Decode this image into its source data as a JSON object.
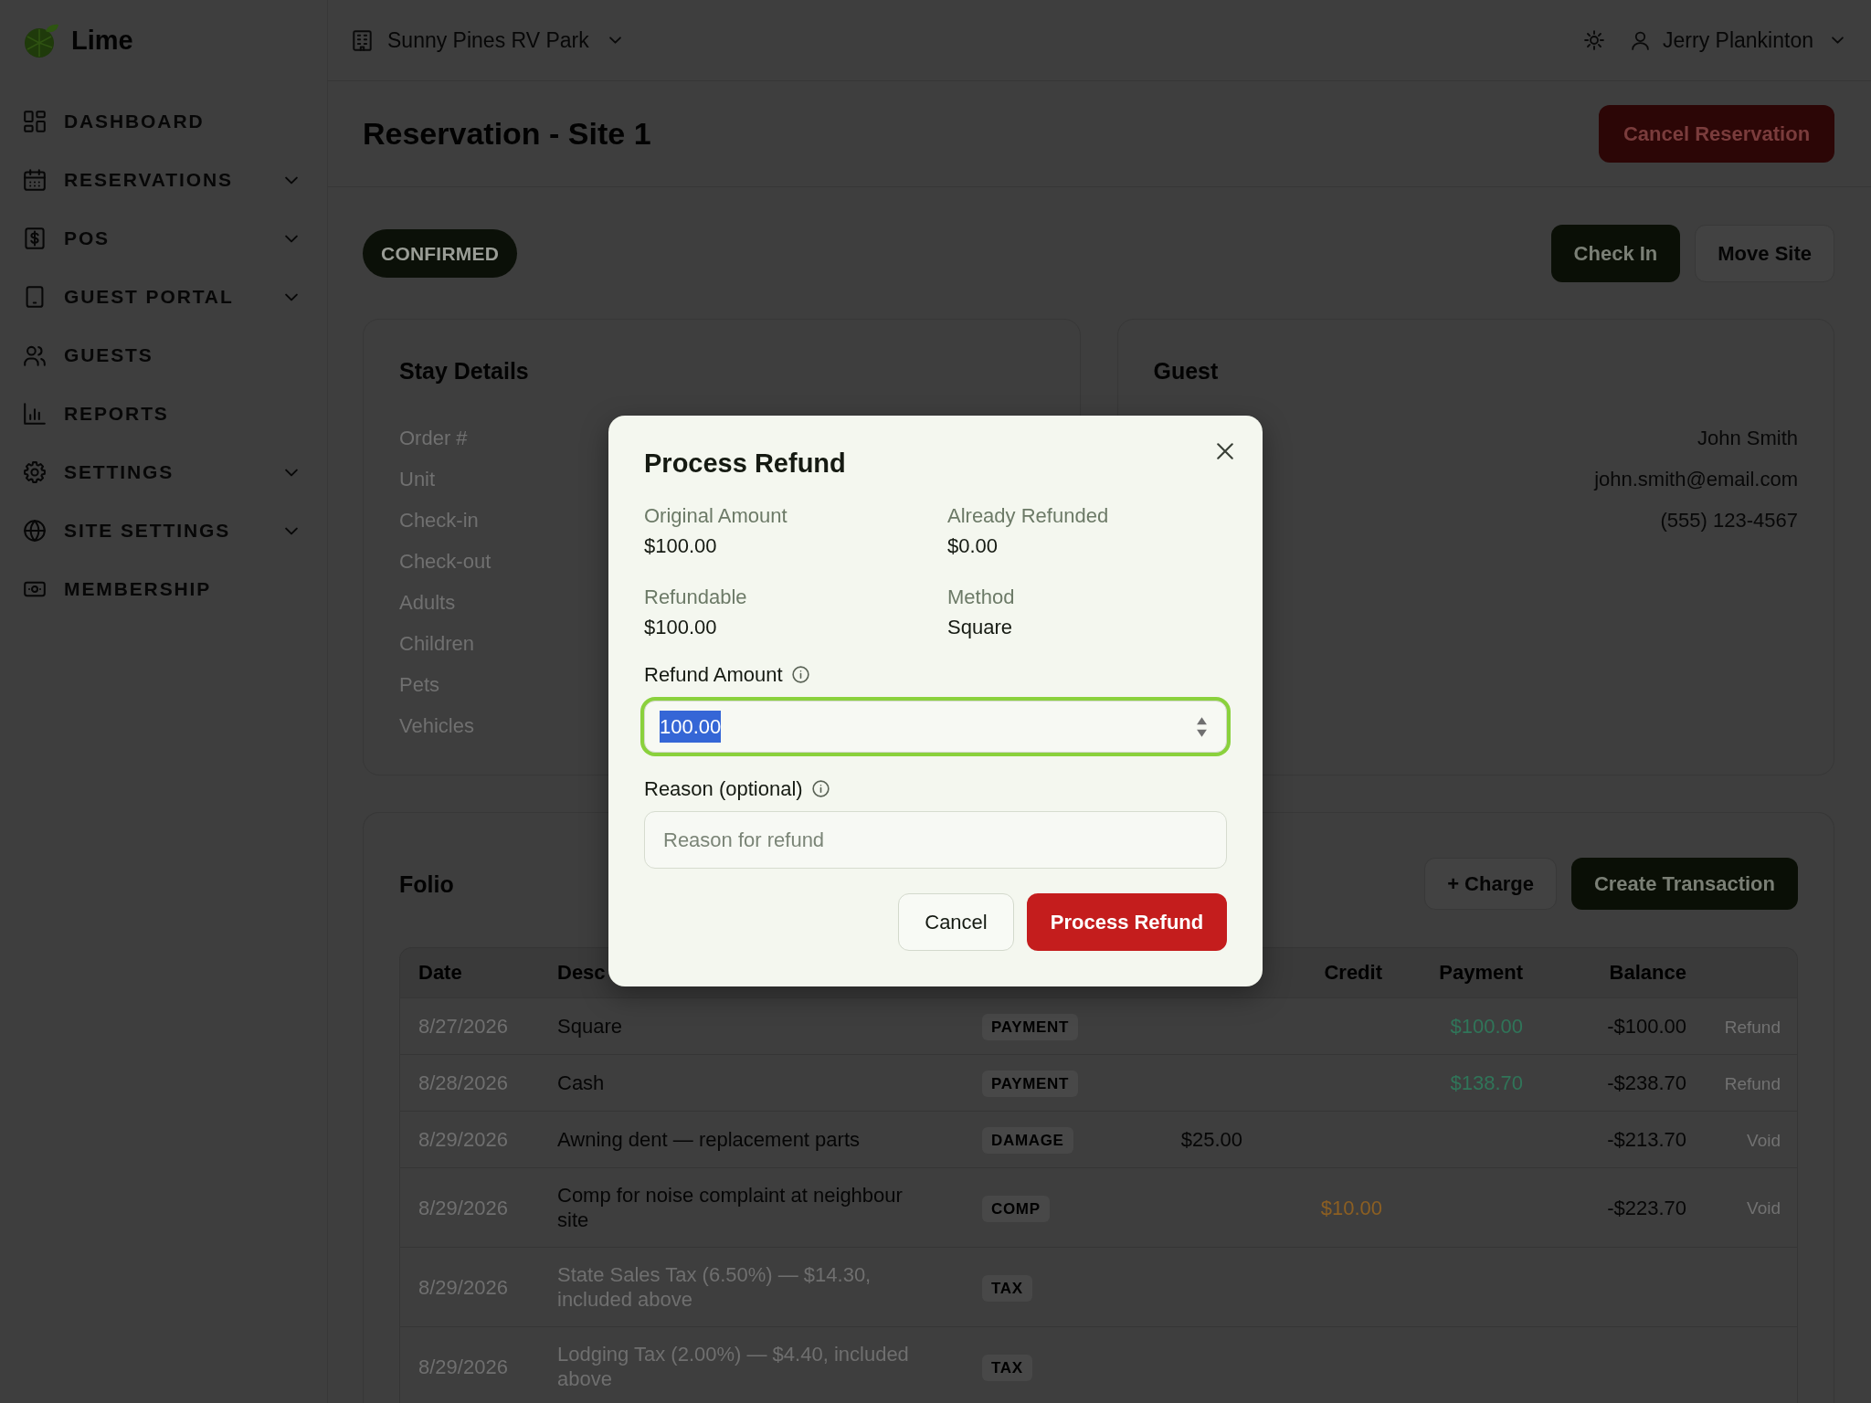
{
  "brand": {
    "name": "Lime"
  },
  "sidebar": {
    "items": [
      {
        "label": "DASHBOARD",
        "submenu": false
      },
      {
        "label": "RESERVATIONS",
        "submenu": true
      },
      {
        "label": "POS",
        "submenu": true
      },
      {
        "label": "GUEST PORTAL",
        "submenu": true
      },
      {
        "label": "GUESTS",
        "submenu": false
      },
      {
        "label": "REPORTS",
        "submenu": false
      },
      {
        "label": "SETTINGS",
        "submenu": true
      },
      {
        "label": "SITE SETTINGS",
        "submenu": true
      },
      {
        "label": "MEMBERSHIP",
        "submenu": false
      }
    ]
  },
  "top_bar": {
    "property": "Sunny Pines RV Park",
    "user": "Jerry Plankinton"
  },
  "header": {
    "title": "Reservation - Site 1",
    "cancel_button": "Cancel Reservation"
  },
  "status": {
    "label": "CONFIRMED"
  },
  "actions": [
    {
      "label": "Check In",
      "kind": "primary"
    },
    {
      "label": "Move Site",
      "kind": "outline"
    }
  ],
  "stay_details": {
    "title": "Stay Details",
    "labels": [
      "Order #",
      "Unit",
      "Check-in",
      "Check-out",
      "Adults",
      "Children",
      "Pets",
      "Vehicles"
    ]
  },
  "guest": {
    "title": "Guest",
    "values": [
      "John Smith",
      "john.smith@email.com",
      "(555) 123-4567"
    ]
  },
  "folio": {
    "title": "Folio",
    "buttons": [
      {
        "label": "+ Charge",
        "kind": "outline"
      },
      {
        "label": "Create Transaction",
        "kind": "primary"
      }
    ],
    "table": {
      "columns": [
        "Date",
        "Desc",
        null,
        null,
        "Credit",
        "Payment",
        "Balance",
        null
      ],
      "rows": [
        {
          "cells": [
            "8/27/2026",
            "Square",
            "PAYMENT",
            null,
            null,
            "$100.00",
            "-$100.00",
            "Refund"
          ],
          "informational": false
        },
        {
          "cells": [
            "8/28/2026",
            "Cash",
            "PAYMENT",
            null,
            null,
            "$138.70",
            "-$238.70",
            "Refund"
          ],
          "informational": false
        },
        {
          "cells": [
            "8/29/2026",
            "Awning dent — replacement parts",
            "DAMAGE",
            "$25.00",
            null,
            null,
            "-$213.70",
            "Void"
          ],
          "informational": false
        },
        {
          "cells": [
            "8/29/2026",
            "Comp for noise complaint at neighbour site",
            "COMP",
            null,
            "$10.00",
            null,
            "-$223.70",
            "Void"
          ],
          "informational": false
        },
        {
          "cells": [
            "8/29/2026",
            "State Sales Tax (6.50%) — $14.30, included above",
            "TAX",
            null,
            null,
            null,
            null,
            null
          ],
          "informational": true
        },
        {
          "cells": [
            "8/29/2026",
            "Lodging Tax (2.00%) — $4.40, included above",
            "TAX",
            null,
            null,
            null,
            null,
            null
          ],
          "informational": true
        }
      ]
    }
  },
  "modal": {
    "title": "Process Refund",
    "summary": [
      {
        "label": "Original Amount",
        "value": "$100.00"
      },
      {
        "label": "Already Refunded",
        "value": "$0.00"
      },
      {
        "label": "Refundable",
        "value": "$100.00"
      },
      {
        "label": "Method",
        "value": "Square"
      }
    ],
    "amount_field": {
      "label": "Refund Amount",
      "value": "100.00",
      "focused": true,
      "text_selected": true
    },
    "reason_field": {
      "label": "Reason (optional)",
      "placeholder": "Reason for refund"
    },
    "buttons": [
      {
        "label": "Cancel",
        "kind": "secondary"
      },
      {
        "label": "Process Refund",
        "kind": "danger"
      }
    ]
  }
}
